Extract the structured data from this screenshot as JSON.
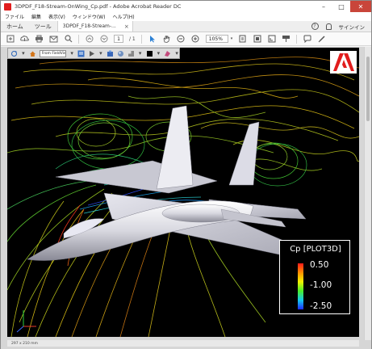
{
  "window": {
    "title": "3DPDF_F18-Stream-OnWing_Cp.pdf - Adobe Acrobat Reader DC",
    "minimize_label": "–",
    "maximize_label": "□",
    "close_label": "✕"
  },
  "menubar": {
    "items": [
      "ファイル",
      "編集",
      "表示(V)",
      "ウィンドウ(W)",
      "ヘルプ(H)"
    ]
  },
  "tabs": {
    "home_label": "ホーム",
    "tools_label": "ツール",
    "document_label": "3DPDF_F18-Stream-...",
    "document_close": "×",
    "help_icon_label": "?",
    "signin_label": "サインイン"
  },
  "toolbar": {
    "current_page": "1",
    "total_pages": "/ 1",
    "zoom": "105%"
  },
  "viewer3d": {
    "view_select": "From FieldView"
  },
  "legend": {
    "title": "Cp [PLOT3D]",
    "max_value": "0.50",
    "mid_value": "-1.00",
    "min_value": "-2.50"
  },
  "statusbar": {
    "page_size": "297 x 210 mm"
  },
  "colors": {
    "adobe_red": "#e11d1d",
    "viewer_background": "#000000",
    "legend_gradient": [
      "#ff1a1a",
      "#ff9a00",
      "#f2f200",
      "#49ef2b",
      "#13c8ee",
      "#1f2bff"
    ]
  }
}
